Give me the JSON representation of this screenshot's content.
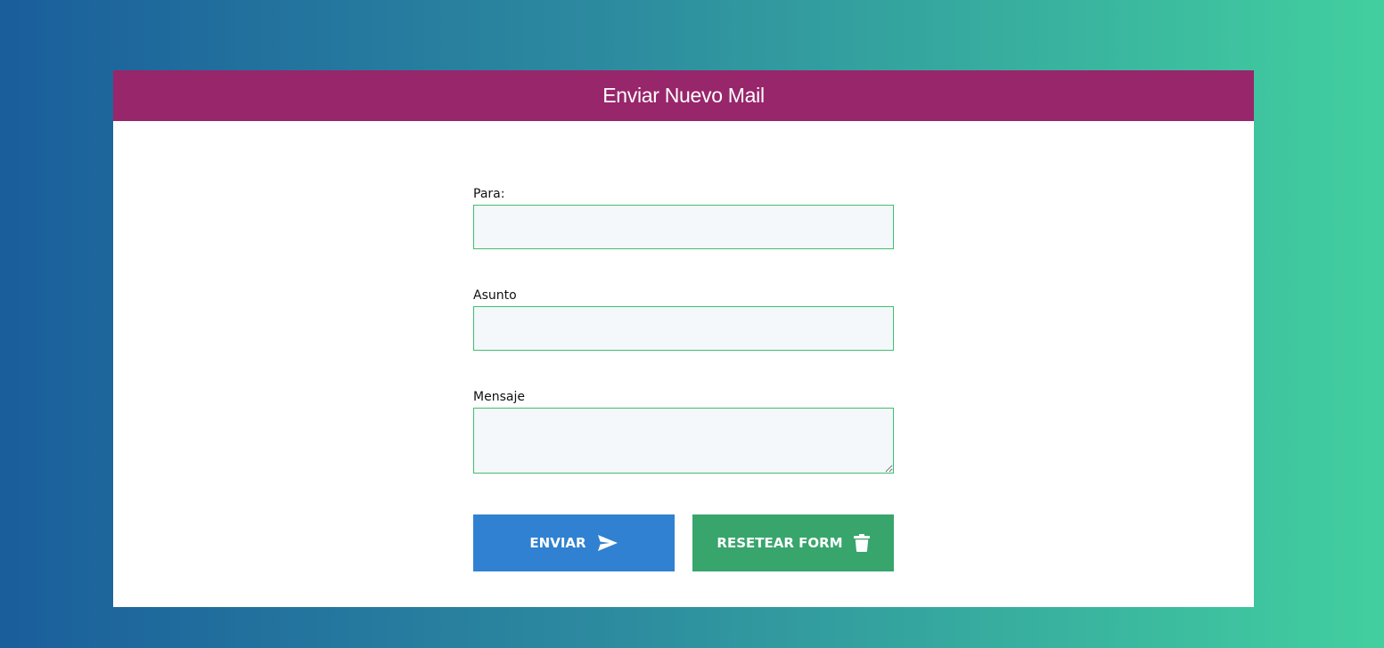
{
  "header": {
    "title": "Enviar Nuevo Mail"
  },
  "form": {
    "to_label": "Para:",
    "to_value": "",
    "subject_label": "Asunto",
    "subject_value": "",
    "message_label": "Mensaje",
    "message_value": ""
  },
  "buttons": {
    "send_label": "ENVIAR",
    "send_icon": "paper-plane-icon",
    "reset_label": "RESETEAR FORM",
    "reset_icon": "trash-icon"
  },
  "colors": {
    "header_bg": "#98266b",
    "send_button": "#3081d1",
    "reset_button": "#38a56c",
    "input_border": "#3fbf6e",
    "input_bg": "#f4f8fa"
  }
}
